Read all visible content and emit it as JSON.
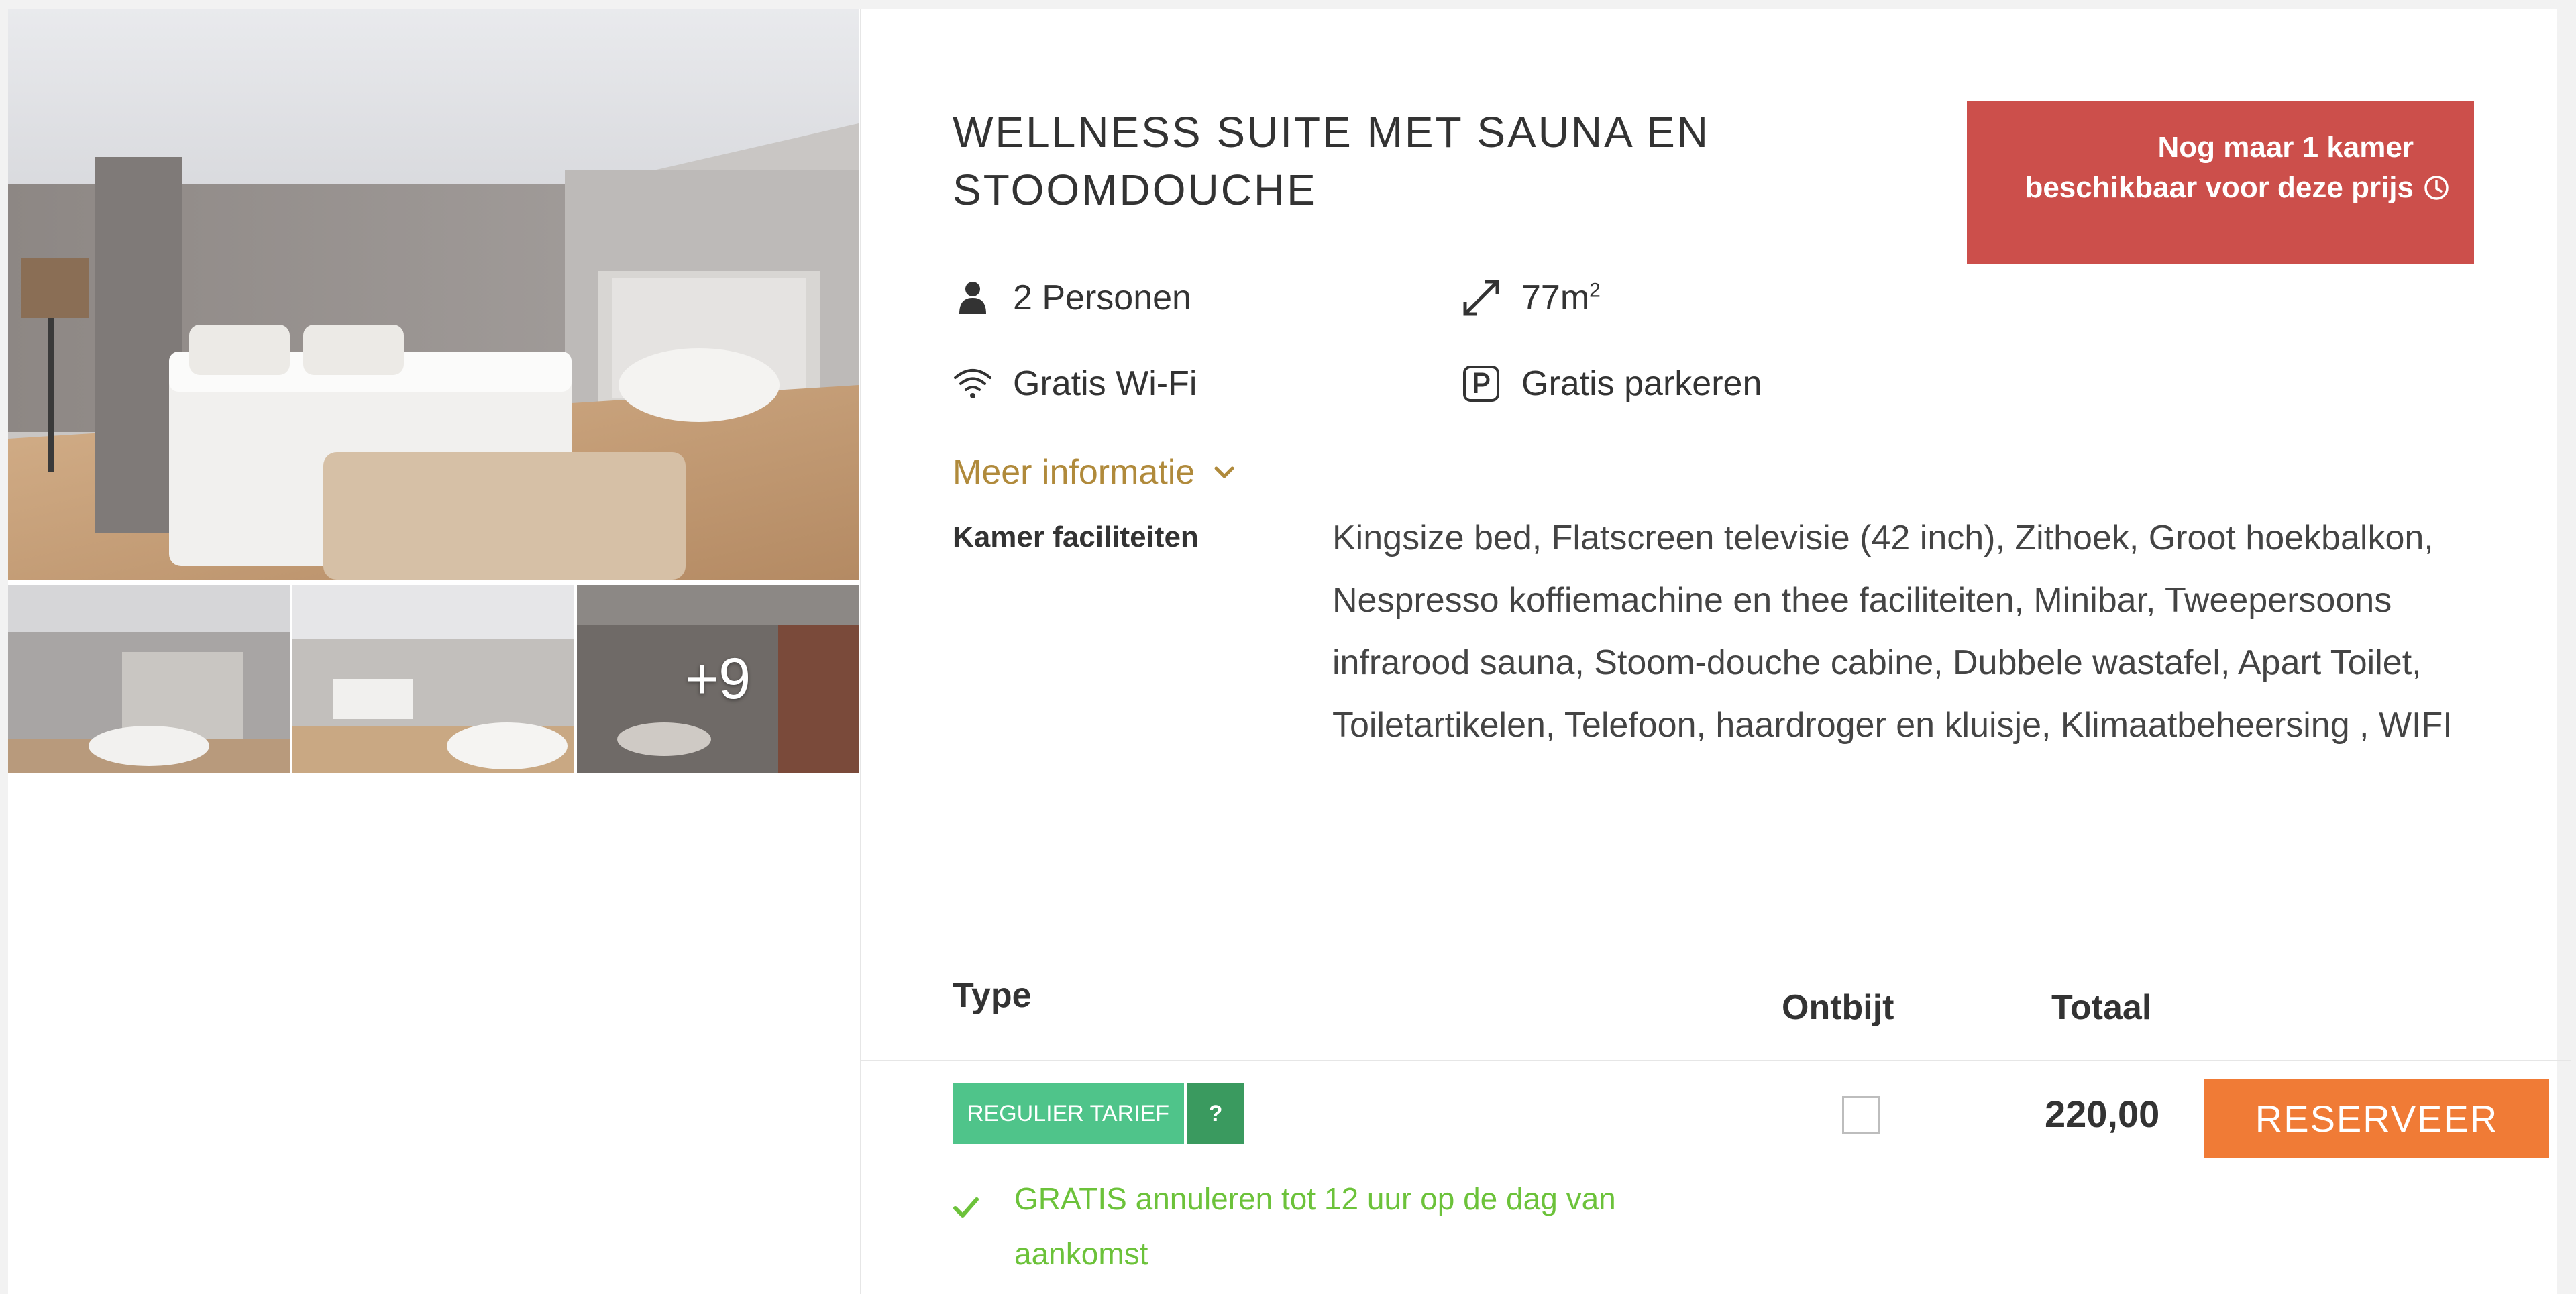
{
  "gallery": {
    "more_photos_label": "+9"
  },
  "room": {
    "title": "WELLNESS SUITE MET SAUNA EN STOOMDOUCHE",
    "availability_alert": "Nog maar 1 kamer beschikbaar voor deze prijs",
    "amenities": {
      "persons": "2 Personen",
      "size": "77m",
      "size_superscript": "2",
      "wifi": "Gratis Wi-Fi",
      "parking": "Gratis parkeren"
    },
    "more_info_label": "Meer informatie",
    "facilities_label": "Kamer faciliteiten",
    "facilities_text": "Kingsize bed, Flatscreen televisie (42 inch), Zithoek, Groot hoekbalkon, Nespresso koffiemachine en thee faciliteiten, Minibar, Tweepersoons infrarood sauna, Stoom-douche cabine, Dubbele wastafel, Apart Toilet, Toiletartikelen, Telefoon, haardroger en kluisje, Klimaatbeheersing , WIFI"
  },
  "rates_table": {
    "headers": {
      "type": "Type",
      "breakfast": "Ontbijt",
      "total": "Totaal"
    },
    "rows": [
      {
        "rate_label": "REGULIER TARIEF",
        "help_label": "?",
        "cancellation": "GRATIS annuleren tot 12 uur op de dag van aankomst",
        "breakfast_checked": false,
        "price": "220,00",
        "reserve_label": "RESERVEER"
      }
    ]
  },
  "colors": {
    "alert_bg": "#cc4f4b",
    "rate_label_bg": "#4fc48a",
    "rate_help_bg": "#3a9a5f",
    "cancellation_text": "#6cc23a",
    "reserve_button_bg": "#f07b36",
    "more_info_text": "#b08a3b"
  },
  "icons": {
    "persons": "person-icon",
    "size": "expand-arrows-icon",
    "wifi": "wifi-icon",
    "parking": "parking-icon",
    "more_info": "chevron-down-icon",
    "alert": "clock-icon",
    "cancellation": "check-icon"
  }
}
